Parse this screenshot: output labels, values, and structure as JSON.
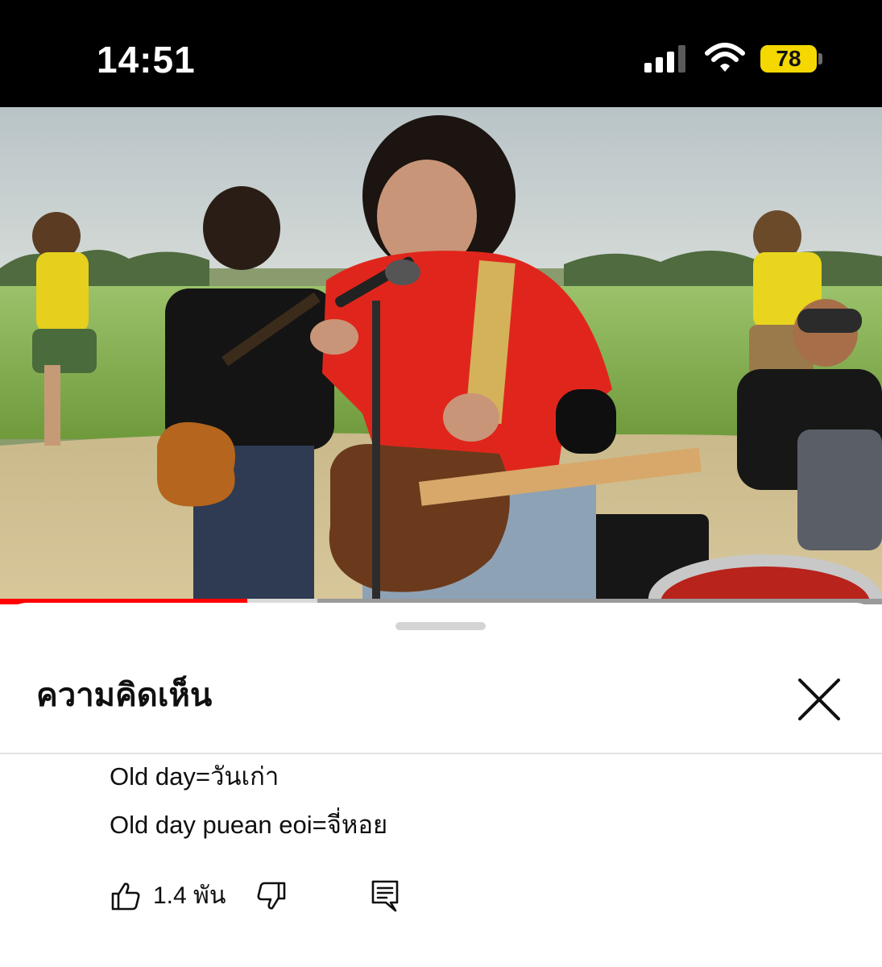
{
  "status_bar": {
    "time": "14:51",
    "battery_level": "78",
    "icons": [
      "cellular-signal-icon",
      "wifi-icon",
      "battery-icon"
    ]
  },
  "video": {
    "progress": 0.28,
    "buffered": 0.36,
    "colors": {
      "progress": "#ff0000",
      "buffered": "#d9d9d9",
      "track": "#9a9a9a"
    }
  },
  "comments_sheet": {
    "title": "ความคิดเห็น",
    "close_icon": "close-icon",
    "comment": {
      "lines": [
        "Old day=วันเก่า",
        "Old day puean eoi=จี่หอย"
      ],
      "like_count": "1.4 พัน",
      "actions": [
        "thumbs-up-icon",
        "thumbs-down-icon",
        "reply-icon"
      ]
    }
  }
}
